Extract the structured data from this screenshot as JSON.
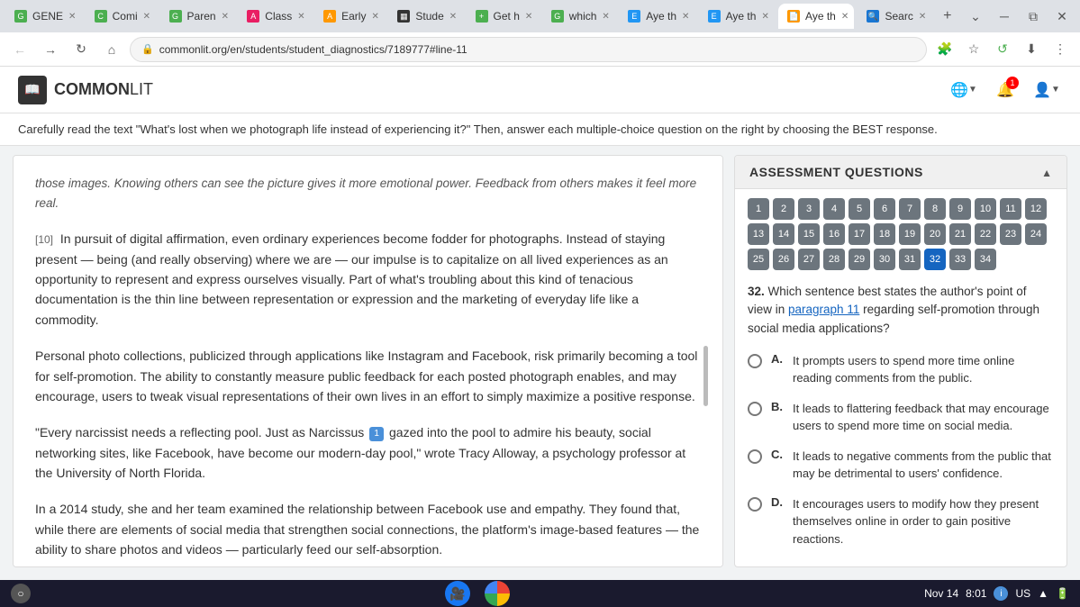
{
  "browser": {
    "tabs": [
      {
        "label": "GENE",
        "favicon_color": "#4caf50",
        "active": false
      },
      {
        "label": "Comi",
        "favicon_color": "#4caf50",
        "active": false
      },
      {
        "label": "Paren",
        "favicon_color": "#4caf50",
        "active": false
      },
      {
        "label": "Class",
        "favicon_color": "#e91e63",
        "active": false
      },
      {
        "label": "Early",
        "favicon_color": "#ff9800",
        "active": false
      },
      {
        "label": "Stude",
        "favicon_color": "#333",
        "active": false
      },
      {
        "label": "Get h",
        "favicon_color": "#4caf50",
        "active": false
      },
      {
        "label": "which",
        "favicon_color": "#4caf50",
        "active": false
      },
      {
        "label": "Aye th",
        "favicon_color": "#2196f3",
        "active": false
      },
      {
        "label": "Aye th",
        "favicon_color": "#2196f3",
        "active": false
      },
      {
        "label": "Aye th",
        "favicon_color": "#ff9800",
        "active": true
      },
      {
        "label": "Searc",
        "favicon_color": "#1976d2",
        "active": false
      }
    ],
    "address": "commonlit.org/en/students/student_diagnostics/7189777#line-11"
  },
  "app": {
    "logo_text": "COMMON",
    "logo_text2": "LIT",
    "instruction": "Carefully read the text \"What's lost when we photograph life instead of experiencing it?\" Then, answer each multiple-choice question on the right by choosing the BEST response."
  },
  "reading": {
    "paragraph_10_label": "[10]",
    "paragraph_10_text": "In pursuit of digital affirmation, even ordinary experiences become fodder for photographs. Instead of staying present — being (and really observing) where we are — our impulse is to capitalize on all lived experiences as an opportunity to represent and express ourselves visually. Part of what's troubling about this kind of tenacious documentation is the thin line between representation or expression and the marketing of everyday life like a commodity.",
    "paragraph_11_text": "Personal photo collections, publicized through applications like Instagram and Facebook, risk primarily becoming a tool for self-promotion. The ability to constantly measure public feedback for each posted photograph enables, and may encourage, users to tweak visual representations of their own lives in an effort to simply maximize a positive response.",
    "paragraph_12_text": "\"Every narcissist needs a reflecting pool. Just as Narcissus",
    "footnote_num": "1",
    "paragraph_12_text2": " gazed into the pool to admire his beauty, social networking sites, like Facebook, have become our modern-day pool,\" wrote Tracy Alloway, a psychology professor at the University of North Florida.",
    "paragraph_13_text": "In a 2014 study, she and her team examined the relationship between Facebook use and empathy. They found that, while there are elements of social media that strengthen social connections, the platform's image-based features — the ability to share photos and videos — particularly feed our self-absorption.",
    "prev_text": "those images. Knowing others can see the picture gives it more emotional power. Feedback from others makes it feel more real."
  },
  "assessment": {
    "title": "ASSESSMENT QUESTIONS",
    "question_numbers": [
      1,
      2,
      3,
      4,
      5,
      6,
      7,
      8,
      9,
      10,
      11,
      12,
      13,
      14,
      15,
      16,
      17,
      18,
      19,
      20,
      21,
      22,
      23,
      24,
      25,
      26,
      27,
      28,
      29,
      30,
      31,
      32,
      33,
      34
    ],
    "active_question": 32,
    "question_num_label": "32.",
    "question_text_part1": "Which sentence best states the author's point of view in ",
    "question_link": "paragraph 11",
    "question_text_part2": " regarding self-promotion through social media applications?",
    "options": [
      {
        "letter": "A.",
        "text": "It prompts users to spend more time online reading comments from the public."
      },
      {
        "letter": "B.",
        "text": "It leads to flattering feedback that may encourage users to spend more time on social media."
      },
      {
        "letter": "C.",
        "text": "It leads to negative comments from the public that may be detrimental to users' confidence."
      },
      {
        "letter": "D.",
        "text": "It encourages users to modify how they present themselves online in order to gain positive reactions."
      }
    ]
  },
  "taskbar": {
    "date": "Nov 14",
    "time": "8:01",
    "country": "US"
  }
}
